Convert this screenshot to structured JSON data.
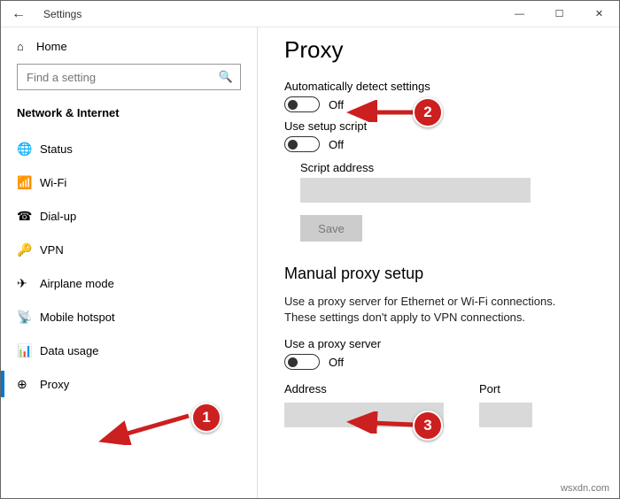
{
  "window": {
    "title": "Settings"
  },
  "sidebar": {
    "home": "Home",
    "search_placeholder": "Find a setting",
    "category": "Network & Internet",
    "items": [
      {
        "label": "Status",
        "icon": "globe"
      },
      {
        "label": "Wi-Fi",
        "icon": "wifi"
      },
      {
        "label": "Dial-up",
        "icon": "dial"
      },
      {
        "label": "VPN",
        "icon": "vpn"
      },
      {
        "label": "Airplane mode",
        "icon": "plane"
      },
      {
        "label": "Mobile hotspot",
        "icon": "hotspot"
      },
      {
        "label": "Data usage",
        "icon": "data"
      },
      {
        "label": "Proxy",
        "icon": "proxy"
      }
    ],
    "selected": "Proxy"
  },
  "main": {
    "title": "Proxy",
    "auto_detect_label": "Automatically detect settings",
    "auto_detect_state": "Off",
    "setup_script_label": "Use setup script",
    "setup_script_state": "Off",
    "script_address_label": "Script address",
    "script_address_value": "",
    "save_button": "Save",
    "manual_heading": "Manual proxy setup",
    "manual_desc": "Use a proxy server for Ethernet or Wi-Fi connections. These settings don't apply to VPN connections.",
    "use_proxy_label": "Use a proxy server",
    "use_proxy_state": "Off",
    "address_label": "Address",
    "address_value": "",
    "port_label": "Port",
    "port_value": ""
  },
  "annotations": {
    "b1": "1",
    "b2": "2",
    "b3": "3"
  },
  "watermark": "wsxdn.com"
}
